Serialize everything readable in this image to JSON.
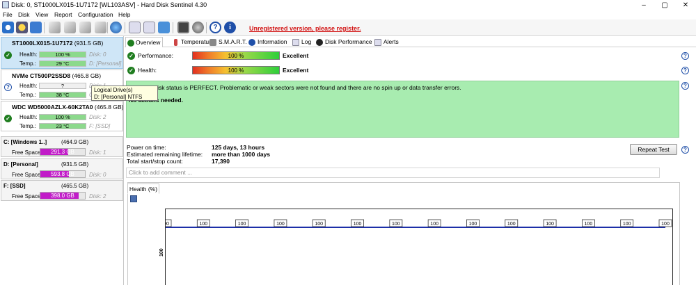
{
  "window": {
    "title": "Disk: 0, ST1000LX015-1U7172 [WL103ASV]  -  Hard Disk Sentinel 4.30",
    "minimize": "–",
    "maximize": "▢",
    "close": "✕"
  },
  "menu": {
    "items": [
      {
        "label": "File"
      },
      {
        "label": "Disk"
      },
      {
        "label": "View"
      },
      {
        "label": "Report"
      },
      {
        "label": "Configuration"
      },
      {
        "label": "Help"
      }
    ]
  },
  "toolbar": {
    "unregistered": "Unregistered version, please register."
  },
  "disks": [
    {
      "name": "ST1000LX015-1U7172",
      "size": "(931.5 GB)",
      "health_label": "Health:",
      "health_value": "100 %",
      "health_pct": 100,
      "disk_label": "Disk: 0",
      "temp_label": "Temp.:",
      "temp_value": "29 °C",
      "drives": "D: [Personal]",
      "status": "ok"
    },
    {
      "name": "NVMe   CT500P2SSD8",
      "size": "(465.8 GB)",
      "health_label": "Health:",
      "health_value": "?",
      "health_pct": 0,
      "disk_label": "Disk: 1",
      "temp_label": "Temp.:",
      "temp_value": "38 °C",
      "drives": "C:",
      "status": "unknown"
    },
    {
      "name": "WDC WD5000AZLX-60K2TA0",
      "size": "(465.8 GB)",
      "health_label": "Health:",
      "health_value": "100 %",
      "health_pct": 100,
      "disk_label": "Disk: 2",
      "temp_label": "Temp.:",
      "temp_value": "23 °C",
      "drives": "F: [SSD]",
      "status": "ok"
    }
  ],
  "volumes": [
    {
      "name": "C: [Windows 1..]",
      "size": "(464.9 GB)",
      "free_label": "Free Space",
      "free": "291.3 GB",
      "free_fraction": 0.63,
      "disk": "Disk: 1"
    },
    {
      "name": "D: [Personal]",
      "size": "(931.5 GB)",
      "free_label": "Free Space",
      "free": "593.8 GB",
      "free_fraction": 0.64,
      "disk": "Disk: 0"
    },
    {
      "name": "F: [SSD]",
      "size": "(465.5 GB)",
      "free_label": "Free Space",
      "free": "398.0 GB",
      "free_fraction": 0.86,
      "disk": "Disk: 2"
    }
  ],
  "tooltip": {
    "line1": "Logical Drive(s)",
    "line2": "D: [Personal] NTFS"
  },
  "tabs": [
    {
      "label": "Overview"
    },
    {
      "label": "Temperature"
    },
    {
      "label": "S.M.A.R.T."
    },
    {
      "label": "Information"
    },
    {
      "label": "Log"
    },
    {
      "label": "Disk Performance"
    },
    {
      "label": "Alerts"
    }
  ],
  "overview": {
    "performance_label": "Performance:",
    "performance_value": "100 %",
    "performance_status": "Excellent",
    "health_label": "Health:",
    "health_value": "100 %",
    "health_status": "Excellent",
    "status_text": "The hard disk status is PERFECT. Problematic or weak sectors were not found and there are no spin up or data transfer errors.",
    "action_text": "No actions needed.",
    "power_on_label": "Power on time:",
    "power_on_value": "125 days, 13 hours",
    "remaining_label": "Estimated remaining lifetime:",
    "remaining_value": "more than 1000 days",
    "startstop_label": "Total start/stop count:",
    "startstop_value": "17,390",
    "repeat_test": "Repeat Test",
    "comment_placeholder": "Click to add comment ..."
  },
  "graph": {
    "tab_label": "Health (%)",
    "y_axis_label": "100"
  },
  "chart_data": {
    "type": "line",
    "title": "Health (%)",
    "x": [
      "",
      "",
      "",
      "",
      "",
      "",
      "",
      "",
      "",
      "",
      "",
      "",
      "",
      ""
    ],
    "series": [
      {
        "values": [
          100,
          100,
          100,
          100,
          100,
          100,
          100,
          100,
          100,
          100,
          100,
          100,
          100,
          100
        ],
        "color": "#1c2fa8"
      }
    ],
    "data_labels": [
      "100",
      "100",
      "100",
      "100",
      "100",
      "100",
      "100",
      "100",
      "100",
      "100",
      "100",
      "100",
      "100",
      "100"
    ]
  }
}
